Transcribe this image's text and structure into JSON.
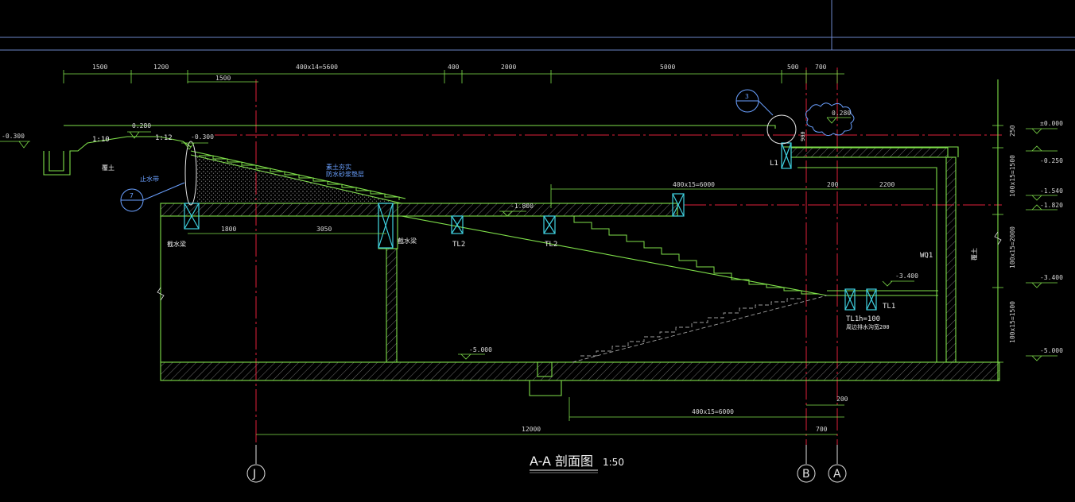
{
  "drawing": {
    "title": "A-A  剖面图",
    "scale": "1:50"
  },
  "grid_labels": {
    "j": "J",
    "b": "B",
    "a": "A"
  },
  "top_dims": [
    "1500",
    "1200",
    "400x14=5600",
    "400",
    "2000",
    "5000",
    "500",
    "700"
  ],
  "sub_dim_1500": "1500",
  "mid_dims": {
    "d1800": "1800",
    "d3050": "3050",
    "stair_top": "400x15=6000",
    "d200": "200",
    "d2200": "2200"
  },
  "bottom_dims": {
    "stair": "400x15=6000",
    "d200": "200",
    "total": "12000",
    "d700": "700"
  },
  "right_dims": [
    "250",
    "100x15=1500",
    "100x15=2000",
    "100x15=1500"
  ],
  "right_levels": [
    "±0.000",
    "-0.250",
    "-1.540",
    "-1.820",
    "-3.400",
    "-5.000"
  ],
  "levels": {
    "left": "-0.300",
    "ramp_top": "0.280",
    "crest": "-0.300",
    "landing": "-1.800",
    "platform": "-3.400",
    "floor": "-5.000",
    "top_right": "0.280"
  },
  "slope": "1:10",
  "slope2": "1:12",
  "callouts": {
    "c7": "7",
    "c3": "3"
  },
  "labels": {
    "l1": "L1",
    "tl2a": "TL2",
    "tl2b": "TL2",
    "tl1a": "TL1",
    "tl1b": "TL1",
    "wq1": "WQ1",
    "h100": "h=100",
    "drain": "周边排水沟宽200",
    "backfill_left": "覆土",
    "backfill_right": "覆土",
    "beam_left": "截水梁",
    "beam_mid": "截水梁",
    "note_a": "素土夯实",
    "note_b": "防水砂浆垫层",
    "note_c": "止水带",
    "d900": "900"
  }
}
